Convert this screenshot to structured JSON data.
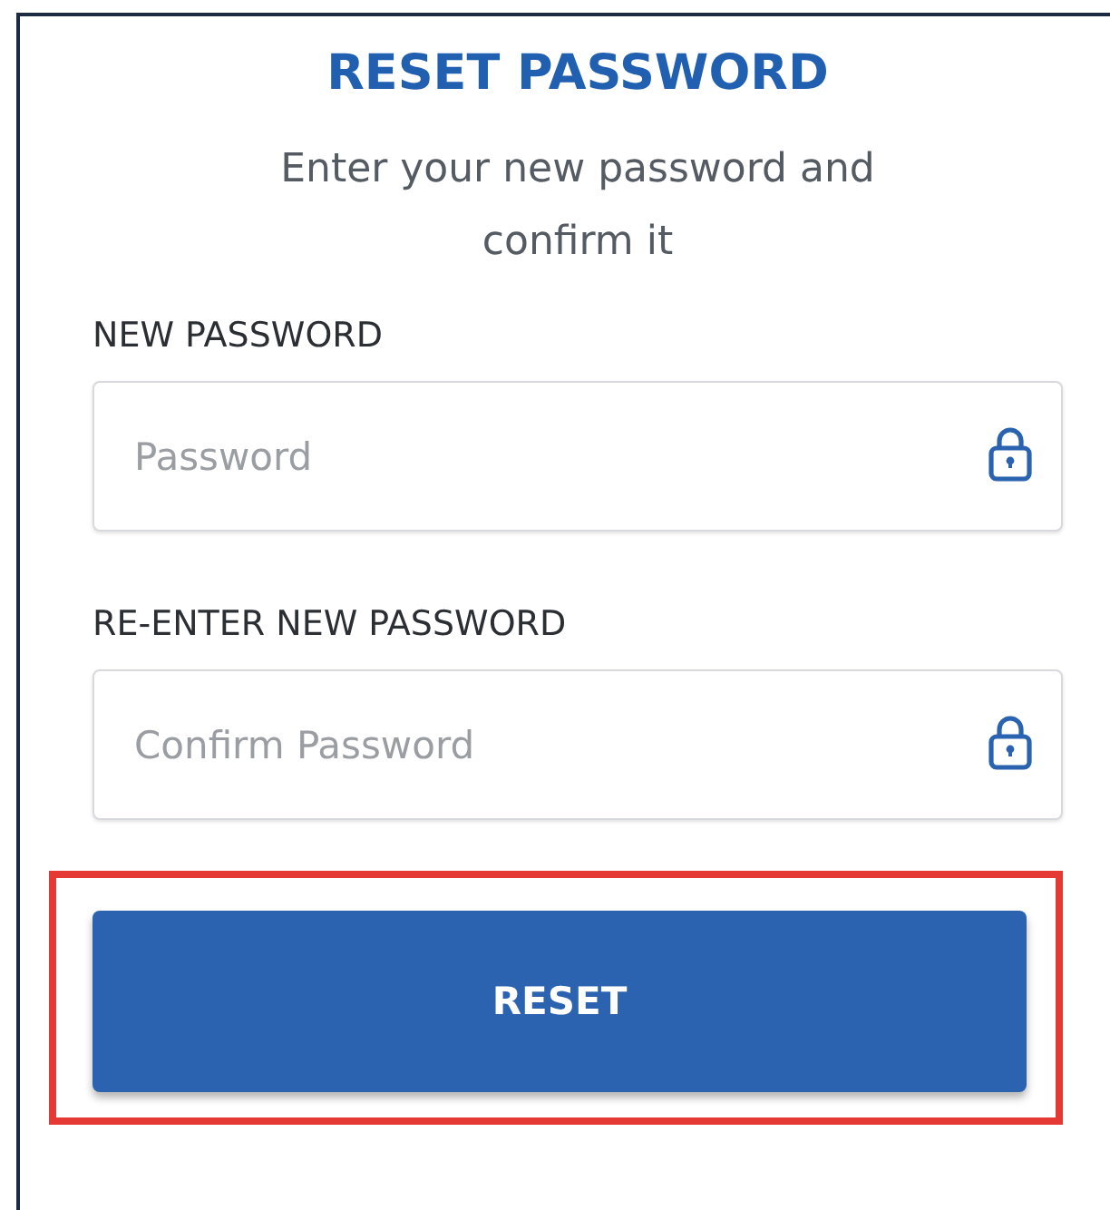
{
  "title": "RESET PASSWORD",
  "subtitle": "Enter your new password and confirm it",
  "fields": [
    {
      "label": "NEW PASSWORD",
      "placeholder": "Password"
    },
    {
      "label": "RE-ENTER NEW PASSWORD",
      "placeholder": "Confirm Password"
    }
  ],
  "button": {
    "label": "RESET",
    "highlighted": true
  }
}
